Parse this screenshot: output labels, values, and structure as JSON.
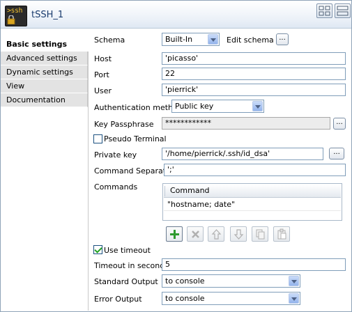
{
  "header": {
    "title": "tSSH_1",
    "component_icon_text": ">ssh"
  },
  "nav": {
    "items": [
      {
        "label": "Basic settings"
      },
      {
        "label": "Advanced settings"
      },
      {
        "label": "Dynamic settings"
      },
      {
        "label": "View"
      },
      {
        "label": "Documentation"
      }
    ]
  },
  "form": {
    "schema_label": "Schema",
    "schema_value": "Built-In",
    "edit_schema_label": "Edit schema",
    "host_label": "Host",
    "host_value": "'picasso'",
    "port_label": "Port",
    "port_value": "22",
    "user_label": "User",
    "user_value": "'pierrick'",
    "auth_label": "Authentication method",
    "auth_value": "Public key",
    "passphrase_label": "Key Passphrase",
    "passphrase_value": "************",
    "pseudo_terminal_label": "Pseudo Terminal",
    "private_key_label": "Private key",
    "private_key_value": "'/home/pierrick/.ssh/id_dsa'",
    "command_separator_label": "Command Separator",
    "command_separator_value": "';'",
    "commands_label": "Commands",
    "commands_header": "Command",
    "commands_rows": [
      "\"hostname; date\""
    ],
    "use_timeout_label": "Use timeout",
    "timeout_label": "Timeout in seconds",
    "timeout_value": "5",
    "stdout_label": "Standard Output",
    "stdout_value": "to console",
    "stderr_label": "Error Output",
    "stderr_value": "to console",
    "dots": "..."
  },
  "state": {
    "pseudo_terminal_checked": false,
    "use_timeout_checked": true
  },
  "colors": {
    "title": "#1a3c6e",
    "add_green": "#2e9a2e",
    "disabled_gray": "#b0b0b0"
  }
}
